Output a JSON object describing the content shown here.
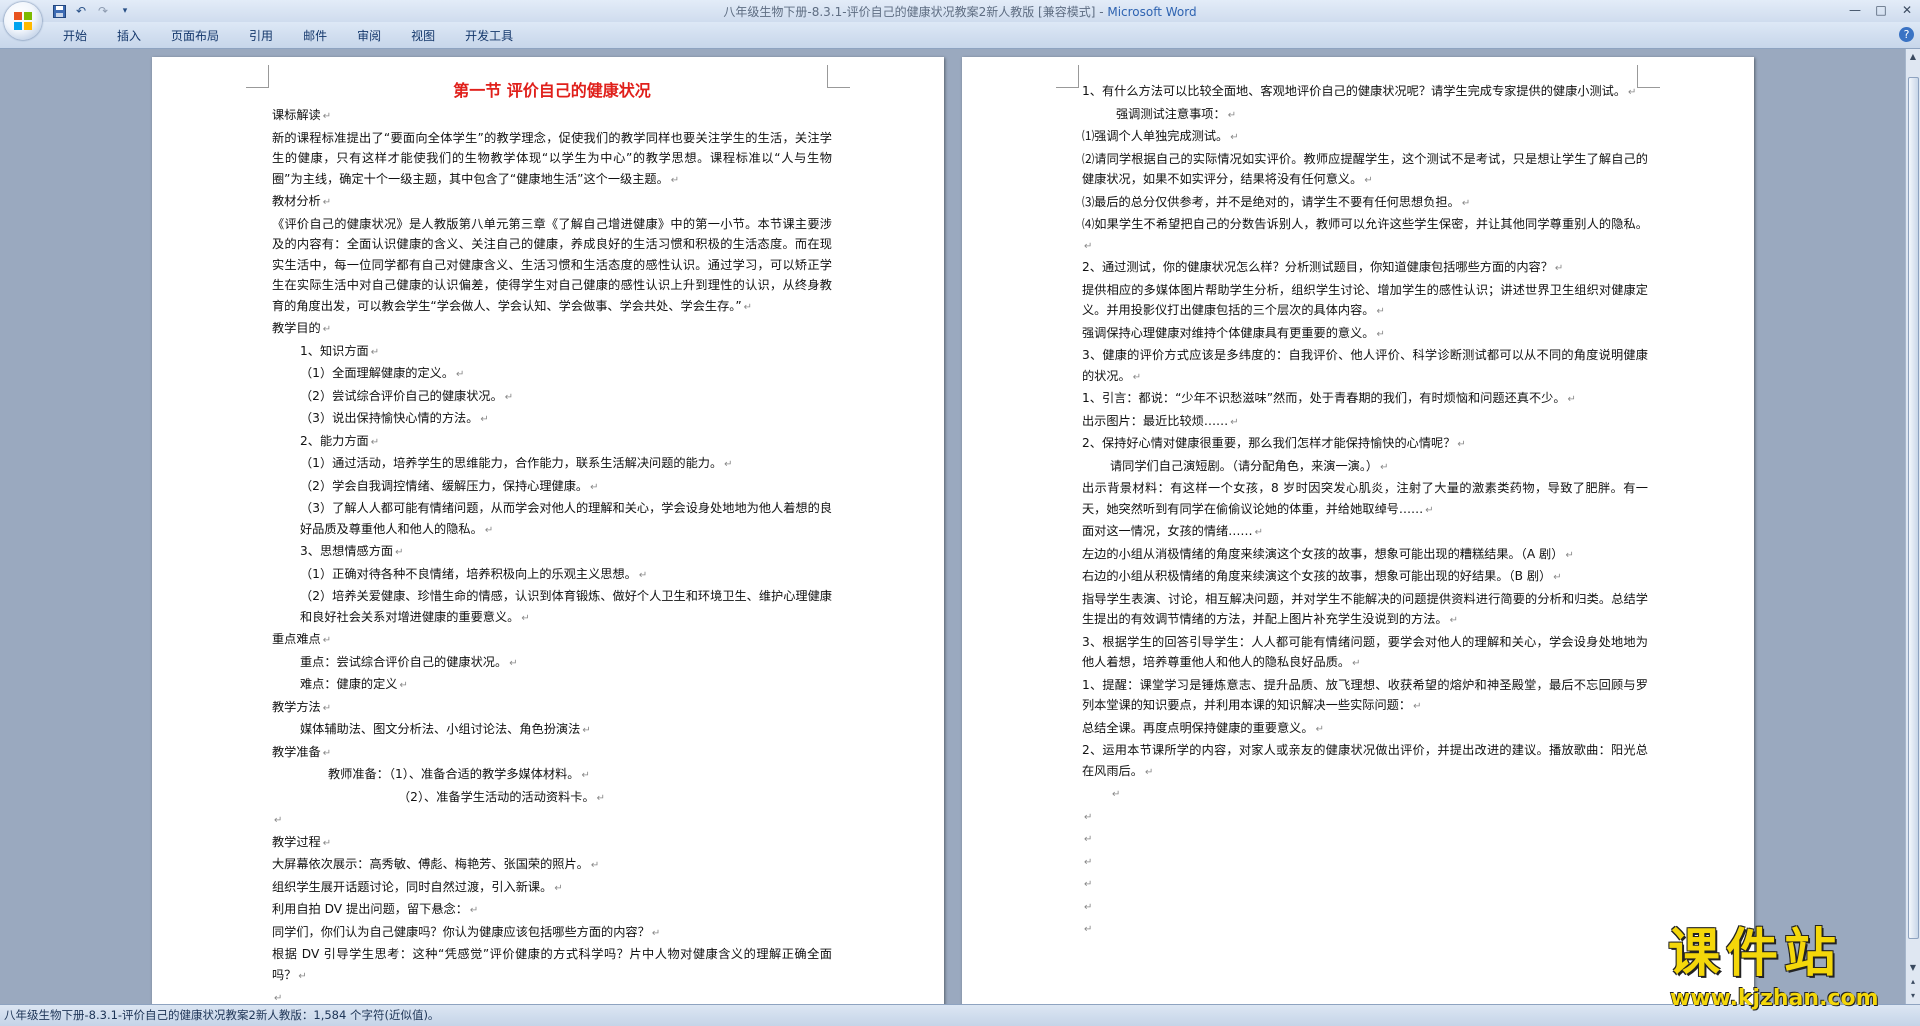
{
  "window": {
    "title_doc": "八年级生物下册-8.3.1-评价自己的健康状况教案2新人教版 [兼容模式] - ",
    "title_app": "Microsoft Word",
    "minimize": "—",
    "maximize": "□",
    "close": "✕"
  },
  "ribbon": {
    "tabs": [
      "开始",
      "插入",
      "页面布局",
      "引用",
      "邮件",
      "审阅",
      "视图",
      "开发工具"
    ],
    "help": "?"
  },
  "page1": {
    "title": "第一节  评价自己的健康状况",
    "lines": [
      {
        "text": "课标解读",
        "cls": "line"
      },
      {
        "text": "新的课程标准提出了“要面向全体学生”的教学理念，促使我们的教学同样也要关注学生的生活，关注学生的健康，只有这样才能使我们的生物教学体现“以学生为中心”的教学思想。课程标准以“人与生物圈”为主线，确定十个一级主题，其中包含了“健康地生活”这个一级主题。",
        "cls": "wrap"
      },
      {
        "text": "教材分析",
        "cls": "line"
      },
      {
        "text": "《评价自己的健康状况》是人教版第八单元第三章《了解自己增进健康》中的第一小节。本节课主要涉及的内容有：全面认识健康的含义、关注自己的健康，养成良好的生活习惯和积极的生活态度。而在现实生活中，每一位同学都有自己对健康含义、生活习惯和生活态度的感性认识。通过学习，可以矫正学生在实际生活中对自己健康的认识偏差，使得学生对自己健康的感性认识上升到理性的认识，从终身教育的角度出发，可以教会学生“学会做人、学会认知、学会做事、学会共处、学会生存。”",
        "cls": "wrap"
      },
      {
        "text": "教学目的",
        "cls": "line"
      },
      {
        "text": "1、知识方面",
        "cls": "line ind1"
      },
      {
        "text": "（1）全面理解健康的定义。",
        "cls": "line ind1"
      },
      {
        "text": "（2）尝试综合评价自己的健康状况。",
        "cls": "line ind1"
      },
      {
        "text": "（3）说出保持愉快心情的方法。",
        "cls": "line ind1"
      },
      {
        "text": "2、能力方面",
        "cls": "line ind1"
      },
      {
        "text": "（1）通过活动，培养学生的思维能力，合作能力，联系生活解决问题的能力。",
        "cls": "line ind1"
      },
      {
        "text": "（2）学会自我调控情绪、缓解压力，保持心理健康。",
        "cls": "line ind1"
      },
      {
        "text": "（3）了解人人都可能有情绪问题，从而学会对他人的理解和关心，学会设身处地地为他人着想的良好品质及尊重他人和他人的隐私。",
        "cls": "wrap ind1"
      },
      {
        "text": "3、思想情感方面",
        "cls": "line ind1"
      },
      {
        "text": "（1）正确对待各种不良情绪，培养积极向上的乐观主义思想。",
        "cls": "line ind1"
      },
      {
        "text": "（2）培养关爱健康、珍惜生命的情感，认识到体育锻炼、做好个人卫生和环境卫生、维护心理健康和良好社会关系对增进健康的重要意义。",
        "cls": "wrap ind1"
      },
      {
        "text": "重点难点",
        "cls": "line"
      },
      {
        "text": "重点：尝试综合评价自己的健康状况。",
        "cls": "line ind1"
      },
      {
        "text": "难点：健康的定义",
        "cls": "line ind1"
      },
      {
        "text": "教学方法",
        "cls": "line"
      },
      {
        "text": "媒体辅助法、图文分析法、小组讨论法、角色扮演法",
        "cls": "line ind1"
      },
      {
        "text": "教学准备",
        "cls": "line"
      },
      {
        "text": "教师准备：（1）、准备合适的教学多媒体材料。",
        "cls": "line ind3"
      },
      {
        "text": "（2）、准备学生活动的活动资料卡。",
        "cls": "line ind4"
      },
      {
        "text": "",
        "cls": "line"
      },
      {
        "text": "教学过程",
        "cls": "line"
      },
      {
        "text": "大屏幕依次展示：高秀敏、傅彪、梅艳芳、张国荣的照片。",
        "cls": "line"
      },
      {
        "text": "组织学生展开话题讨论，同时自然过渡，引入新课。",
        "cls": "line"
      },
      {
        "text": "利用自拍 DV 提出问题，留下悬念：",
        "cls": "line"
      },
      {
        "text": "同学们，你们认为自己健康吗？你认为健康应该包括哪些方面的内容？",
        "cls": "line"
      },
      {
        "text": "根据 DV 引导学生思考：这种“凭感觉”评价健康的方式科学吗？片中人物对健康含义的理解正确全面吗？",
        "cls": "wrap"
      },
      {
        "text": "",
        "cls": "line"
      }
    ]
  },
  "page2": {
    "lines": [
      {
        "text": "1、有什么方法可以比较全面地、客观地评价自己的健康状况呢？请学生完成专家提供的健康小测试。",
        "cls": "wrap"
      },
      {
        "text": "强调测试注意事项：",
        "cls": "line ind2"
      },
      {
        "text": "⑴强调个人单独完成测试。",
        "cls": "line"
      },
      {
        "text": "⑵请同学根据自己的实际情况如实评价。教师应提醒学生，这个测试不是考试，只是想让学生了解自己的健康状况，如果不如实评分，结果将没有任何意义。",
        "cls": "wrap"
      },
      {
        "text": "⑶最后的总分仅供参考，并不是绝对的，请学生不要有任何思想负担。",
        "cls": "line"
      },
      {
        "text": "⑷如果学生不希望把自己的分数告诉别人，教师可以允许这些学生保密，并让其他同学尊重别人的隐私。",
        "cls": "wrap"
      },
      {
        "text": "2、通过测试，你的健康状况怎么样？分析测试题目，你知道健康包括哪些方面的内容？",
        "cls": "line"
      },
      {
        "text": "提供相应的多媒体图片帮助学生分析，组织学生讨论、增加学生的感性认识；讲述世界卫生组织对健康定义。并用投影仪打出健康包括的三个层次的具体内容。",
        "cls": "wrap"
      },
      {
        "text": "强调保持心理健康对维持个体健康具有更重要的意义。",
        "cls": "line"
      },
      {
        "text": "3、健康的评价方式应该是多纬度的：自我评价、他人评价、科学诊断测试都可以从不同的角度说明健康的状况。",
        "cls": "wrap"
      },
      {
        "text": "1、引言：都说：“少年不识愁滋味”然而，处于青春期的我们，有时烦恼和问题还真不少。",
        "cls": "line"
      },
      {
        "text": "出示图片：最近比较烦……",
        "cls": "line"
      },
      {
        "text": "2、保持好心情对健康很重要，那么我们怎样才能保持愉快的心情呢？",
        "cls": "line"
      },
      {
        "text": "请同学们自己演短剧。（请分配角色，来演一演。）",
        "cls": "line ind1"
      },
      {
        "text": "出示背景材料：有这样一个女孩，8 岁时因突发心肌炎，注射了大量的激素类药物，导致了肥胖。有一天，她突然听到有同学在偷偷议论她的体重，并给她取绰号……",
        "cls": "wrap"
      },
      {
        "text": "面对这一情况，女孩的情绪……",
        "cls": "line"
      },
      {
        "text": "左边的小组从消极情绪的角度来续演这个女孩的故事，想象可能出现的糟糕结果。（A 剧）",
        "cls": "line"
      },
      {
        "text": "右边的小组从积极情绪的角度来续演这个女孩的故事，想象可能出现的好结果。（B 剧）",
        "cls": "line"
      },
      {
        "text": "指导学生表演、讨论，相互解决问题，并对学生不能解决的问题提供资料进行简要的分析和归类。总结学生提出的有效调节情绪的方法，并配上图片补充学生没说到的方法。",
        "cls": "wrap"
      },
      {
        "text": "3、根据学生的回答引导学生：人人都可能有情绪问题，要学会对他人的理解和关心，学会设身处地地为他人着想，培养尊重他人和他人的隐私良好品质。",
        "cls": "wrap"
      },
      {
        "text": "1、提醒：课堂学习是锤炼意志、提升品质、放飞理想、收获希望的熔炉和神圣殿堂，最后不忘回顾与罗列本堂课的知识要点，并利用本课的知识解决一些实际问题：",
        "cls": "wrap"
      },
      {
        "text": "总结全课。再度点明保持健康的重要意义。",
        "cls": "line"
      },
      {
        "text": "2、运用本节课所学的内容，对家人或亲友的健康状况做出评价，并提出改进的建议。播放歌曲：阳光总在风雨后。",
        "cls": "wrap"
      },
      {
        "text": "",
        "cls": "line ind1"
      },
      {
        "text": "",
        "cls": "line"
      },
      {
        "text": "",
        "cls": "line"
      },
      {
        "text": "",
        "cls": "line"
      },
      {
        "text": "",
        "cls": "line"
      },
      {
        "text": "",
        "cls": "line"
      },
      {
        "text": "",
        "cls": "line"
      }
    ]
  },
  "status": {
    "text": "八年级生物下册-8.3.1-评价自己的健康状况教案2新人教版：1,584 个字符(近似值)。"
  },
  "watermark": {
    "cn": "课件站",
    "url": "www.kjzhan.com"
  },
  "colors": {
    "title_red": "#e0201b",
    "watermark_yellow": "#f4d70a",
    "ribbon_blue": "#15386c"
  }
}
